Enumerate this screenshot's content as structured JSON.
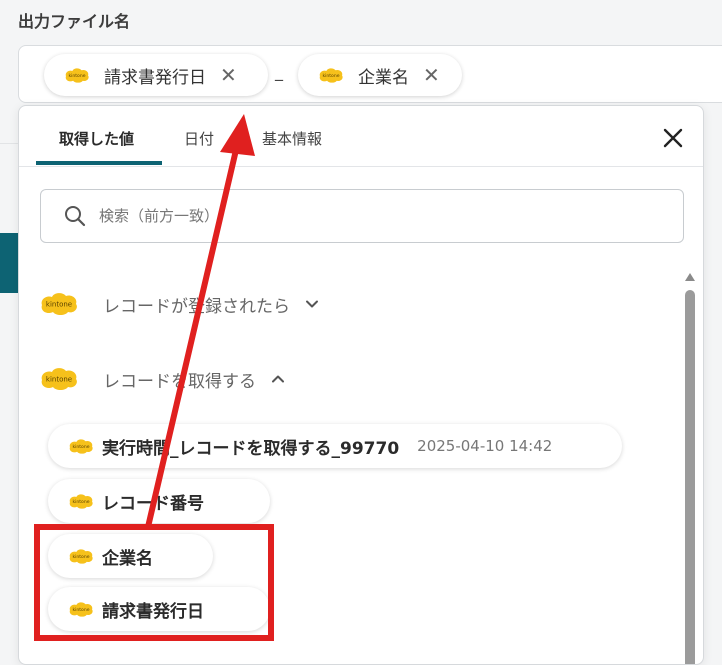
{
  "background": {
    "label": "出力ファイル名",
    "chips": [
      {
        "label": "請求書発行日"
      },
      {
        "label": "企業名"
      }
    ],
    "separator": "_"
  },
  "panel": {
    "tabs": [
      {
        "label": "取得した値",
        "active": true
      },
      {
        "label": "日付",
        "active": false
      },
      {
        "label": "基本情報",
        "active": false
      }
    ],
    "search": {
      "placeholder": "検索（前方一致）",
      "value": ""
    },
    "sections": [
      {
        "label": "レコードが登録されたら",
        "expanded": false
      },
      {
        "label": "レコードを取得する",
        "expanded": true
      }
    ],
    "items": [
      {
        "name": "実行時間_レコードを取得する_99770",
        "value": "2025-04-10 14:42"
      },
      {
        "name": "レコード番号",
        "value": ""
      },
      {
        "name": "企業名",
        "value": ""
      },
      {
        "name": "請求書発行日",
        "value": ""
      }
    ],
    "logo_text": "kintone"
  },
  "colors": {
    "accent": "#0d6373",
    "kintone_yellow": "#f6c11b",
    "annotation_red": "#e0201f"
  },
  "icons": {
    "close": "close-icon",
    "search": "search-icon",
    "expand": "chevron-down-icon",
    "collapse": "chevron-up-icon"
  }
}
